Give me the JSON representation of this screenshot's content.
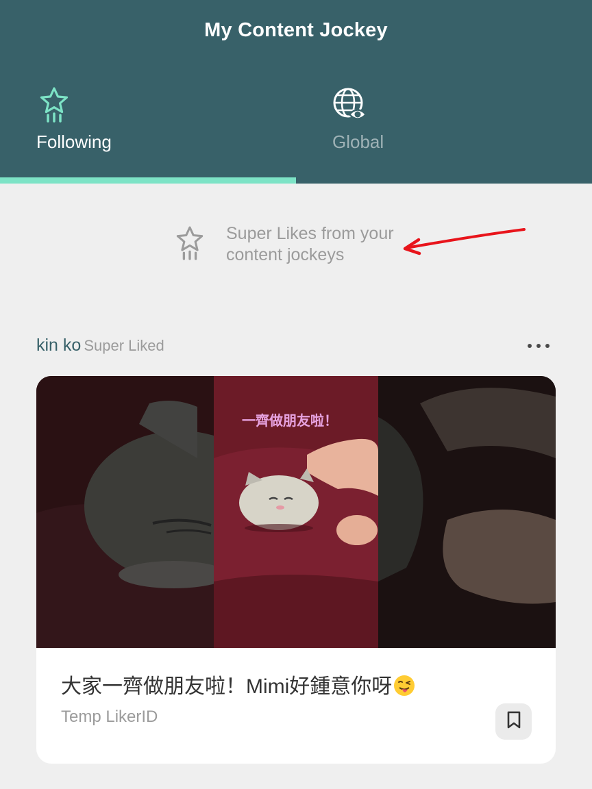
{
  "header": {
    "title": "My Content Jockey",
    "tabs": [
      {
        "label": "Following",
        "icon": "super-like-star-icon",
        "active": true
      },
      {
        "label": "Global",
        "icon": "globe-eye-icon",
        "active": false
      }
    ],
    "active_indicator_color": "#7de3c6"
  },
  "hint": {
    "icon": "super-like-star-icon",
    "text": "Super Likes from your content jockeys"
  },
  "post": {
    "author": "kin ko",
    "action": "Super Liked",
    "more_icon": "more-dots-icon",
    "thumbnail_caption": "一齊做朋友啦！",
    "title": "大家一齊做朋友啦！Mimi好鍾意你呀",
    "title_emoji": "winking-face-with-tongue",
    "byline": "Temp LikerID",
    "bookmark_icon": "bookmark-icon"
  },
  "colors": {
    "header_bg": "#386169",
    "accent": "#7de3c6",
    "page_bg": "#efefef",
    "muted_text": "#9b9b9b",
    "annotation_arrow": "#e8141b"
  }
}
